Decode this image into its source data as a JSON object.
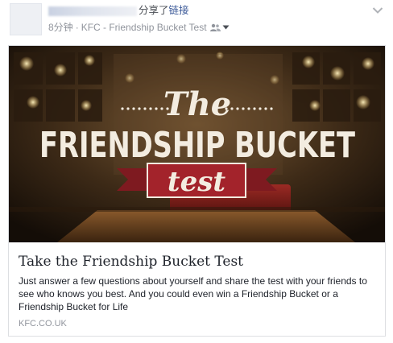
{
  "post": {
    "action_text": "分享了",
    "action_link": "链接",
    "time": "8分钟",
    "separator": "·",
    "source": "KFC - Friendship Bucket Test"
  },
  "icons": {
    "audience": "friends-icon",
    "audience_dropdown": "triangle-down-icon",
    "menu": "chevron-down-icon"
  },
  "link_card": {
    "image_text": {
      "the": "The",
      "headline": "FRIENDSHIP BUCKET",
      "ribbon": "test"
    },
    "title": "Take the Friendship Bucket Test",
    "description": "Just answer a few questions about yourself and share the test with your friends to see who knows you best. And you could even win a Friendship Bucket or a Friendship Bucket for Life",
    "domain": "KFC.CO.UK"
  },
  "colors": {
    "link": "#3b5998",
    "meta": "#90949c",
    "text": "#1d2129",
    "ribbon_red": "#a3232b",
    "card_border": "#dddfe2"
  }
}
